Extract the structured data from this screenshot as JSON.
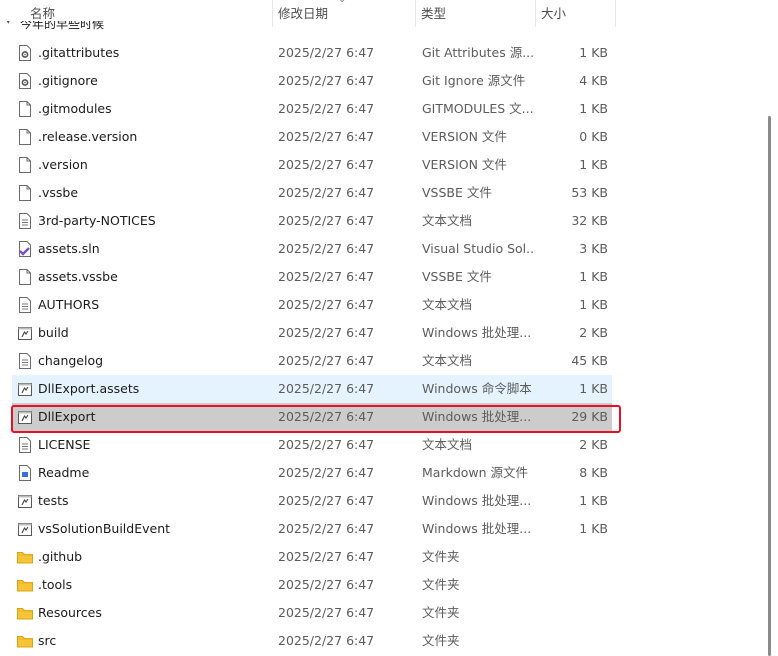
{
  "columns": {
    "name": "名称",
    "date": "修改日期",
    "type": "类型",
    "size": "大小"
  },
  "group_header": "今年的早些时候",
  "files": [
    {
      "name": ".gitattributes",
      "date": "2025/2/27 6:47",
      "type": "Git Attributes 源...",
      "size": "1 KB",
      "icon": "gear-file-icon"
    },
    {
      "name": ".gitignore",
      "date": "2025/2/27 6:47",
      "type": "Git Ignore 源文件",
      "size": "4 KB",
      "icon": "gear-file-icon"
    },
    {
      "name": ".gitmodules",
      "date": "2025/2/27 6:47",
      "type": "GITMODULES 文...",
      "size": "1 KB",
      "icon": "blank-file-icon"
    },
    {
      "name": ".release.version",
      "date": "2025/2/27 6:47",
      "type": "VERSION 文件",
      "size": "0 KB",
      "icon": "blank-file-icon"
    },
    {
      "name": ".version",
      "date": "2025/2/27 6:47",
      "type": "VERSION 文件",
      "size": "1 KB",
      "icon": "blank-file-icon"
    },
    {
      "name": ".vssbe",
      "date": "2025/2/27 6:47",
      "type": "VSSBE 文件",
      "size": "53 KB",
      "icon": "blank-file-icon"
    },
    {
      "name": "3rd-party-NOTICES",
      "date": "2025/2/27 6:47",
      "type": "文本文档",
      "size": "32 KB",
      "icon": "text-file-icon"
    },
    {
      "name": "assets.sln",
      "date": "2025/2/27 6:47",
      "type": "Visual Studio Sol...",
      "size": "3 KB",
      "icon": "visual-studio-icon"
    },
    {
      "name": "assets.vssbe",
      "date": "2025/2/27 6:47",
      "type": "VSSBE 文件",
      "size": "1 KB",
      "icon": "blank-file-icon"
    },
    {
      "name": "AUTHORS",
      "date": "2025/2/27 6:47",
      "type": "文本文档",
      "size": "1 KB",
      "icon": "text-file-icon"
    },
    {
      "name": "build",
      "date": "2025/2/27 6:47",
      "type": "Windows 批处理...",
      "size": "2 KB",
      "icon": "batch-file-icon"
    },
    {
      "name": "changelog",
      "date": "2025/2/27 6:47",
      "type": "文本文档",
      "size": "45 KB",
      "icon": "text-file-icon"
    },
    {
      "name": "DllExport.assets",
      "date": "2025/2/27 6:47",
      "type": "Windows 命令脚本",
      "size": "1 KB",
      "icon": "batch-file-icon"
    },
    {
      "name": "DllExport",
      "date": "2025/2/27 6:47",
      "type": "Windows 批处理...",
      "size": "29 KB",
      "icon": "batch-file-icon"
    },
    {
      "name": "LICENSE",
      "date": "2025/2/27 6:47",
      "type": "文本文档",
      "size": "2 KB",
      "icon": "text-file-icon"
    },
    {
      "name": "Readme",
      "date": "2025/2/27 6:47",
      "type": "Markdown 源文件",
      "size": "8 KB",
      "icon": "markdown-file-icon"
    },
    {
      "name": "tests",
      "date": "2025/2/27 6:47",
      "type": "Windows 批处理...",
      "size": "1 KB",
      "icon": "batch-file-icon"
    },
    {
      "name": "vsSolutionBuildEvent",
      "date": "2025/2/27 6:47",
      "type": "Windows 批处理...",
      "size": "1 KB",
      "icon": "batch-file-icon"
    },
    {
      "name": ".github",
      "date": "2025/2/27 6:47",
      "type": "文件夹",
      "size": "",
      "icon": "folder-icon"
    },
    {
      "name": ".tools",
      "date": "2025/2/27 6:47",
      "type": "文件夹",
      "size": "",
      "icon": "folder-icon"
    },
    {
      "name": "Resources",
      "date": "2025/2/27 6:47",
      "type": "文件夹",
      "size": "",
      "icon": "folder-icon"
    },
    {
      "name": "src",
      "date": "2025/2/27 6:47",
      "type": "文件夹",
      "size": "",
      "icon": "folder-icon"
    }
  ],
  "hover_row": "DllExport.assets",
  "selected_row": "DllExport",
  "colors": {
    "hover_bg": "#e5f3ff",
    "selected_bg": "#cccccc",
    "highlight_border": "#e81123",
    "folder": "#f8c437"
  }
}
